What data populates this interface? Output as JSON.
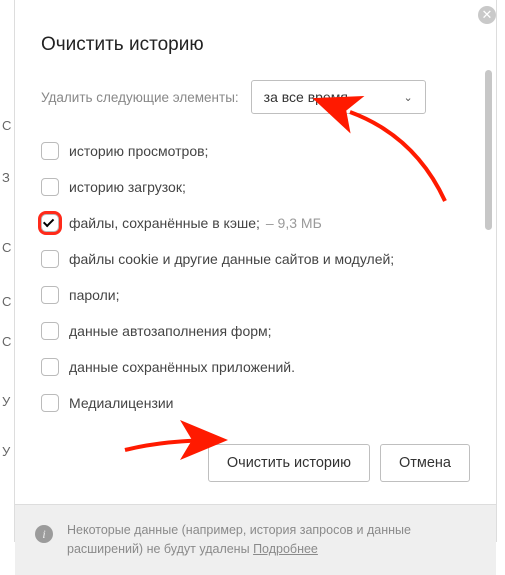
{
  "title": "Очистить историю",
  "time_row": {
    "label": "Удалить следующие элементы:",
    "selected": "за все время"
  },
  "options": [
    {
      "label": "историю просмотров;",
      "checked": false,
      "extra": null
    },
    {
      "label": "историю загрузок;",
      "checked": false,
      "extra": null
    },
    {
      "label": "файлы, сохранённые в кэше;",
      "checked": true,
      "extra": "–  9,3 МБ",
      "highlight": true
    },
    {
      "label": "файлы cookie и другие данные сайтов и модулей;",
      "checked": false,
      "extra": null
    },
    {
      "label": "пароли;",
      "checked": false,
      "extra": null
    },
    {
      "label": "данные автозаполнения форм;",
      "checked": false,
      "extra": null
    },
    {
      "label": "данные сохранённых приложений.",
      "checked": false,
      "extra": null
    },
    {
      "label": "Медиалицензии",
      "checked": false,
      "extra": null
    }
  ],
  "buttons": {
    "clear": "Очистить историю",
    "cancel": "Отмена"
  },
  "footer": {
    "text": "Некоторые данные (например, история запросов и данные расширений) не будут удалены ",
    "link": "Подробнее"
  }
}
